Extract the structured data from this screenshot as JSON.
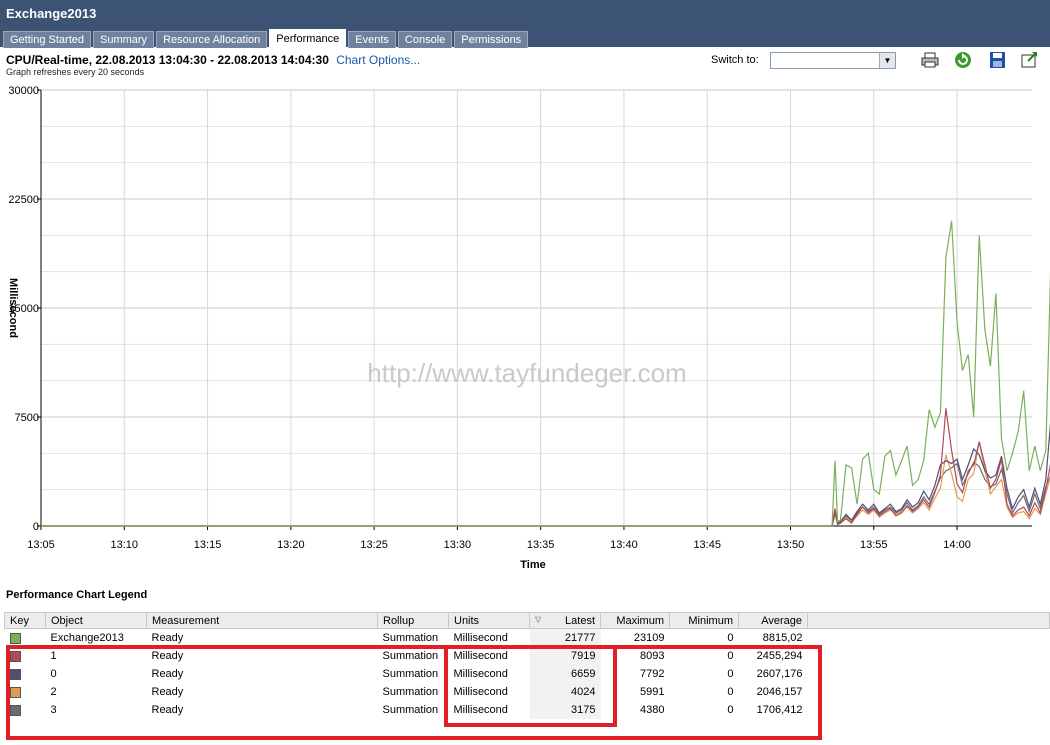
{
  "app": {
    "title": "Exchange2013"
  },
  "tabs": [
    {
      "label": "Getting Started",
      "active": false
    },
    {
      "label": "Summary",
      "active": false
    },
    {
      "label": "Resource Allocation",
      "active": false
    },
    {
      "label": "Performance",
      "active": true
    },
    {
      "label": "Events",
      "active": false
    },
    {
      "label": "Console",
      "active": false
    },
    {
      "label": "Permissions",
      "active": false
    }
  ],
  "header": {
    "title": "CPU/Real-time, 22.08.2013 13:04:30 - 22.08.2013 14:04:30",
    "chart_options": "Chart Options...",
    "refresh_note": "Graph refreshes every 20 seconds",
    "switch_to_label": "Switch to:",
    "switch_to_value": ""
  },
  "toolbar": {
    "icons": [
      "print-icon",
      "refresh-icon",
      "save-icon",
      "popout-icon"
    ]
  },
  "watermark": "http://www.tayfundeger.com",
  "chart_data": {
    "type": "line",
    "xlabel": "Time",
    "ylabel": "Millisecond",
    "ylim": [
      0,
      30000
    ],
    "yticks": [
      "0",
      "7500",
      "15000",
      "22500",
      "30000"
    ],
    "xticks": [
      "13:05",
      "13:10",
      "13:15",
      "13:20",
      "13:25",
      "13:30",
      "13:35",
      "13:40",
      "13:45",
      "13:50",
      "13:55",
      "14:00"
    ],
    "x_start": "13:05",
    "x_end": "14:04:30",
    "grid": true,
    "series": [
      {
        "name": "Exchange2013",
        "color": "#7ab05c",
        "points": [
          [
            47.5,
            0
          ],
          [
            47.67,
            4500
          ],
          [
            47.83,
            300
          ],
          [
            48,
            400
          ],
          [
            48.33,
            4200
          ],
          [
            48.67,
            4000
          ],
          [
            49,
            1500
          ],
          [
            49.33,
            4600
          ],
          [
            49.67,
            5000
          ],
          [
            50,
            2500
          ],
          [
            50.33,
            2200
          ],
          [
            50.67,
            4800
          ],
          [
            51,
            5200
          ],
          [
            51.33,
            3500
          ],
          [
            51.67,
            4500
          ],
          [
            52,
            5500
          ],
          [
            52.33,
            2800
          ],
          [
            52.67,
            3200
          ],
          [
            53,
            4500
          ],
          [
            53.33,
            8000
          ],
          [
            53.67,
            6800
          ],
          [
            54,
            7800
          ],
          [
            54.33,
            18500
          ],
          [
            54.67,
            21000
          ],
          [
            55,
            14000
          ],
          [
            55.33,
            10700
          ],
          [
            55.67,
            11800
          ],
          [
            56,
            7500
          ],
          [
            56.33,
            20000
          ],
          [
            56.67,
            13500
          ],
          [
            57,
            11000
          ],
          [
            57.33,
            16000
          ],
          [
            57.67,
            6000
          ],
          [
            58,
            3800
          ],
          [
            58.33,
            5000
          ],
          [
            58.67,
            6500
          ],
          [
            59,
            9300
          ],
          [
            59.33,
            3800
          ],
          [
            59.67,
            5500
          ],
          [
            60,
            3800
          ],
          [
            60.33,
            5200
          ],
          [
            60.67,
            19800
          ],
          [
            61,
            13500
          ],
          [
            61.33,
            11500
          ],
          [
            61.67,
            16500
          ],
          [
            62,
            18800
          ],
          [
            62.33,
            19700
          ],
          [
            62.67,
            23100
          ],
          [
            63,
            21800
          ]
        ]
      },
      {
        "name": "1",
        "color": "#b24a5a",
        "points": [
          [
            47.5,
            0
          ],
          [
            47.67,
            1200
          ],
          [
            47.83,
            100
          ],
          [
            48,
            200
          ],
          [
            48.33,
            500
          ],
          [
            48.67,
            200
          ],
          [
            49,
            800
          ],
          [
            49.33,
            1300
          ],
          [
            49.67,
            900
          ],
          [
            50,
            1200
          ],
          [
            50.33,
            700
          ],
          [
            50.67,
            1000
          ],
          [
            51,
            1200
          ],
          [
            51.33,
            700
          ],
          [
            51.67,
            900
          ],
          [
            52,
            1400
          ],
          [
            52.33,
            1000
          ],
          [
            52.67,
            1300
          ],
          [
            53,
            1800
          ],
          [
            53.33,
            1300
          ],
          [
            53.67,
            2300
          ],
          [
            54,
            3500
          ],
          [
            54.33,
            8100
          ],
          [
            54.67,
            5200
          ],
          [
            55,
            2900
          ],
          [
            55.33,
            2300
          ],
          [
            55.67,
            3800
          ],
          [
            56,
            4200
          ],
          [
            56.33,
            5800
          ],
          [
            56.67,
            4200
          ],
          [
            57,
            2600
          ],
          [
            57.33,
            3200
          ],
          [
            57.67,
            4600
          ],
          [
            58,
            1500
          ],
          [
            58.33,
            700
          ],
          [
            58.67,
            1100
          ],
          [
            59,
            1300
          ],
          [
            59.33,
            700
          ],
          [
            59.67,
            1600
          ],
          [
            60,
            900
          ],
          [
            60.33,
            2500
          ],
          [
            60.67,
            4600
          ],
          [
            61,
            3200
          ],
          [
            61.33,
            3600
          ],
          [
            61.67,
            4900
          ],
          [
            62,
            6000
          ],
          [
            62.33,
            5800
          ],
          [
            62.67,
            8100
          ],
          [
            63,
            7900
          ]
        ]
      },
      {
        "name": "0",
        "color": "#4d5070",
        "points": [
          [
            47.5,
            0
          ],
          [
            47.67,
            1000
          ],
          [
            47.83,
            200
          ],
          [
            48,
            300
          ],
          [
            48.33,
            800
          ],
          [
            48.67,
            400
          ],
          [
            49,
            1000
          ],
          [
            49.33,
            1500
          ],
          [
            49.67,
            1100
          ],
          [
            50,
            1500
          ],
          [
            50.33,
            900
          ],
          [
            50.67,
            1200
          ],
          [
            51,
            1500
          ],
          [
            51.33,
            1000
          ],
          [
            51.67,
            1200
          ],
          [
            52,
            1800
          ],
          [
            52.33,
            1300
          ],
          [
            52.67,
            1600
          ],
          [
            53,
            2400
          ],
          [
            53.33,
            1800
          ],
          [
            53.67,
            2800
          ],
          [
            54,
            4200
          ],
          [
            54.33,
            4500
          ],
          [
            54.67,
            4300
          ],
          [
            55,
            4600
          ],
          [
            55.33,
            3200
          ],
          [
            55.67,
            4200
          ],
          [
            56,
            5300
          ],
          [
            56.33,
            4900
          ],
          [
            56.67,
            3800
          ],
          [
            57,
            3300
          ],
          [
            57.33,
            3500
          ],
          [
            57.67,
            4800
          ],
          [
            58,
            2600
          ],
          [
            58.33,
            1200
          ],
          [
            58.67,
            2000
          ],
          [
            59,
            2500
          ],
          [
            59.33,
            1300
          ],
          [
            59.67,
            2600
          ],
          [
            60,
            1500
          ],
          [
            60.33,
            3200
          ],
          [
            60.67,
            7800
          ],
          [
            61,
            4200
          ],
          [
            61.33,
            3900
          ],
          [
            61.67,
            5000
          ],
          [
            62,
            4500
          ],
          [
            62.33,
            5800
          ],
          [
            62.67,
            5200
          ],
          [
            63,
            6659
          ]
        ]
      },
      {
        "name": "2",
        "color": "#e39a55",
        "points": [
          [
            47.5,
            0
          ],
          [
            47.67,
            900
          ],
          [
            47.83,
            100
          ],
          [
            48,
            200
          ],
          [
            48.33,
            600
          ],
          [
            48.67,
            300
          ],
          [
            49,
            700
          ],
          [
            49.33,
            1100
          ],
          [
            49.67,
            800
          ],
          [
            50,
            1100
          ],
          [
            50.33,
            600
          ],
          [
            50.67,
            900
          ],
          [
            51,
            1100
          ],
          [
            51.33,
            800
          ],
          [
            51.67,
            1000
          ],
          [
            52,
            1300
          ],
          [
            52.33,
            900
          ],
          [
            52.67,
            1200
          ],
          [
            53,
            1600
          ],
          [
            53.33,
            1100
          ],
          [
            53.67,
            1900
          ],
          [
            54,
            2600
          ],
          [
            54.33,
            4900
          ],
          [
            54.67,
            3600
          ],
          [
            55,
            2000
          ],
          [
            55.33,
            1700
          ],
          [
            55.67,
            3200
          ],
          [
            56,
            3600
          ],
          [
            56.33,
            5800
          ],
          [
            56.67,
            3800
          ],
          [
            57,
            2200
          ],
          [
            57.33,
            2700
          ],
          [
            57.67,
            3200
          ],
          [
            58,
            1300
          ],
          [
            58.33,
            600
          ],
          [
            58.67,
            900
          ],
          [
            59,
            1000
          ],
          [
            59.33,
            500
          ],
          [
            59.67,
            1200
          ],
          [
            60,
            800
          ],
          [
            60.33,
            2200
          ],
          [
            60.67,
            3700
          ],
          [
            61,
            2600
          ],
          [
            61.33,
            3100
          ],
          [
            61.67,
            4500
          ],
          [
            62,
            5200
          ],
          [
            62.33,
            4700
          ],
          [
            62.67,
            5991
          ],
          [
            63,
            4024
          ]
        ]
      },
      {
        "name": "3",
        "color": "#6b6b78",
        "points": [
          [
            47.5,
            0
          ],
          [
            47.67,
            800
          ],
          [
            47.83,
            150
          ],
          [
            48,
            250
          ],
          [
            48.33,
            700
          ],
          [
            48.67,
            300
          ],
          [
            49,
            900
          ],
          [
            49.33,
            1300
          ],
          [
            49.67,
            1000
          ],
          [
            50,
            1300
          ],
          [
            50.33,
            800
          ],
          [
            50.67,
            1100
          ],
          [
            51,
            1300
          ],
          [
            51.33,
            900
          ],
          [
            51.67,
            1100
          ],
          [
            52,
            1600
          ],
          [
            52.33,
            1100
          ],
          [
            52.67,
            1400
          ],
          [
            53,
            2000
          ],
          [
            53.33,
            1500
          ],
          [
            53.67,
            2400
          ],
          [
            54,
            3300
          ],
          [
            54.33,
            3800
          ],
          [
            54.67,
            4000
          ],
          [
            55,
            4300
          ],
          [
            55.33,
            2800
          ],
          [
            55.67,
            3600
          ],
          [
            56,
            4380
          ],
          [
            56.33,
            4100
          ],
          [
            56.67,
            3200
          ],
          [
            57,
            2700
          ],
          [
            57.33,
            2900
          ],
          [
            57.67,
            3900
          ],
          [
            58,
            2200
          ],
          [
            58.33,
            900
          ],
          [
            58.67,
            1600
          ],
          [
            59,
            2100
          ],
          [
            59.33,
            1000
          ],
          [
            59.67,
            2200
          ],
          [
            60,
            1200
          ],
          [
            60.33,
            2700
          ],
          [
            60.67,
            3600
          ],
          [
            61,
            2900
          ],
          [
            61.33,
            3000
          ],
          [
            61.67,
            3800
          ],
          [
            62,
            3400
          ],
          [
            62.33,
            3900
          ],
          [
            62.67,
            3700
          ],
          [
            63,
            3175
          ]
        ]
      }
    ]
  },
  "legend": {
    "title": "Performance Chart Legend",
    "columns": [
      "Key",
      "Object",
      "Measurement",
      "Rollup",
      "Units",
      "Latest",
      "Maximum",
      "Minimum",
      "Average"
    ],
    "rows": [
      {
        "color": "#7ab05c",
        "object": "Exchange2013",
        "measurement": "Ready",
        "rollup": "Summation",
        "units": "Millisecond",
        "latest": "21777",
        "maximum": "23109",
        "minimum": "0",
        "average": "8815,02"
      },
      {
        "color": "#b24a5a",
        "object": "1",
        "measurement": "Ready",
        "rollup": "Summation",
        "units": "Millisecond",
        "latest": "7919",
        "maximum": "8093",
        "minimum": "0",
        "average": "2455,294"
      },
      {
        "color": "#4d5070",
        "object": "0",
        "measurement": "Ready",
        "rollup": "Summation",
        "units": "Millisecond",
        "latest": "6659",
        "maximum": "7792",
        "minimum": "0",
        "average": "2607,176"
      },
      {
        "color": "#e39a55",
        "object": "2",
        "measurement": "Ready",
        "rollup": "Summation",
        "units": "Millisecond",
        "latest": "4024",
        "maximum": "5991",
        "minimum": "0",
        "average": "2046,157"
      },
      {
        "color": "#6b6b78",
        "object": "3",
        "measurement": "Ready",
        "rollup": "Summation",
        "units": "Millisecond",
        "latest": "3175",
        "maximum": "4380",
        "minimum": "0",
        "average": "1706,412"
      }
    ]
  }
}
